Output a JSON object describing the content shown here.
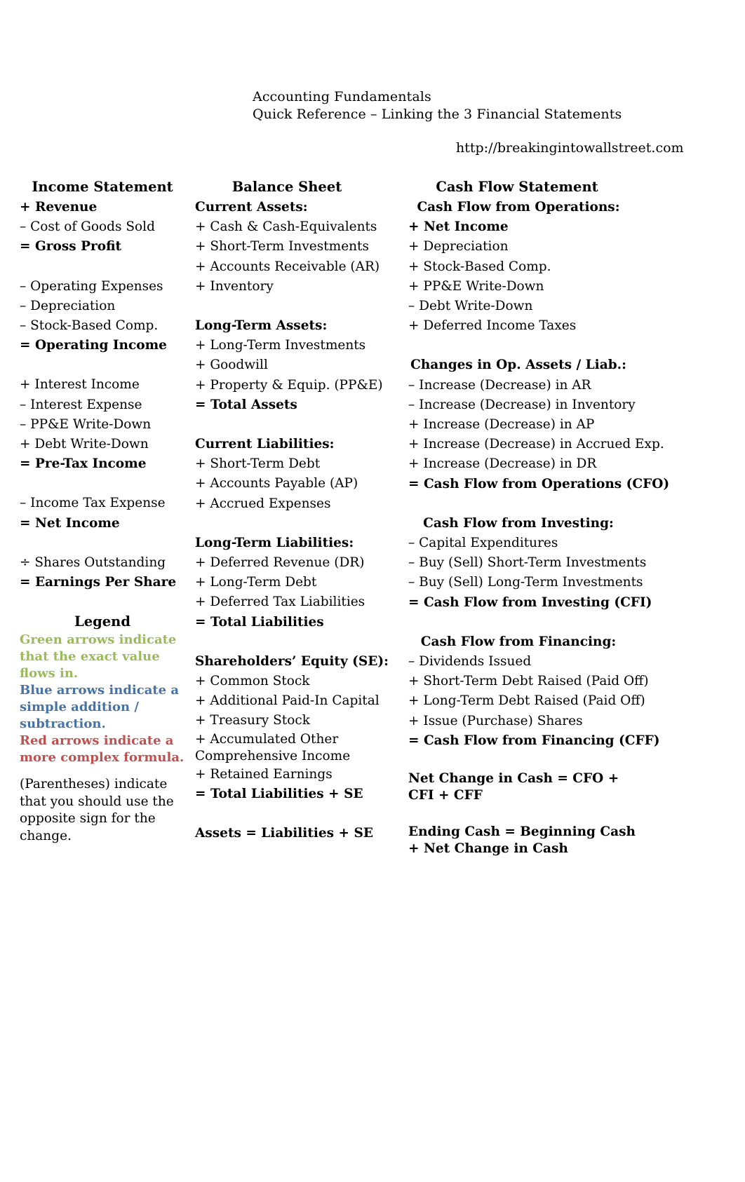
{
  "header": {
    "title_line1": "Accounting Fundamentals",
    "title_line2": "Quick Reference – Linking the 3 Financial Statements",
    "url": "http://breakingintowallstreet.com"
  },
  "colors": {
    "green": "#9BBB59",
    "blue": "#4573A7",
    "red": "#C0504D",
    "text": "#000000"
  },
  "income_statement": {
    "title": "Income Statement",
    "lines": [
      {
        "text": "+ Revenue",
        "bold": true
      },
      {
        "text": "– Cost of Goods Sold",
        "bold": false
      },
      {
        "text": "= Gross Profit",
        "bold": true
      },
      {
        "text": "",
        "bold": false
      },
      {
        "text": "– Operating Expenses",
        "bold": false
      },
      {
        "text": "– Depreciation",
        "bold": false
      },
      {
        "text": "– Stock-Based Comp.",
        "bold": false
      },
      {
        "text": "= Operating Income",
        "bold": true
      },
      {
        "text": "",
        "bold": false
      },
      {
        "text": "+ Interest Income",
        "bold": false
      },
      {
        "text": "– Interest Expense",
        "bold": false
      },
      {
        "text": "– PP&E Write-Down",
        "bold": false
      },
      {
        "text": "+ Debt Write-Down",
        "bold": false
      },
      {
        "text": "= Pre-Tax Income",
        "bold": true
      },
      {
        "text": "",
        "bold": false
      },
      {
        "text": "– Income Tax Expense",
        "bold": false
      },
      {
        "text": "= Net Income",
        "bold": true
      },
      {
        "text": "",
        "bold": false
      },
      {
        "text": "÷ Shares Outstanding",
        "bold": false
      },
      {
        "text": "= Earnings Per Share",
        "bold": true
      }
    ]
  },
  "legend": {
    "title": "Legend",
    "items": [
      {
        "text": "Green arrows indicate that the exact value flows in.",
        "color": "green"
      },
      {
        "text": "Blue arrows indicate a simple addition / subtraction.",
        "color": "blue"
      },
      {
        "text": "Red arrows indicate a more complex formula.",
        "color": "red"
      }
    ],
    "note": "(Parentheses) indicate that you should use the opposite sign for the change."
  },
  "balance_sheet": {
    "title": "Balance Sheet",
    "lines": [
      {
        "text": "Current Assets:",
        "bold": true
      },
      {
        "text": "+ Cash & Cash-Equivalents",
        "bold": false
      },
      {
        "text": "+ Short-Term Investments",
        "bold": false
      },
      {
        "text": "+ Accounts Receivable (AR)",
        "bold": false
      },
      {
        "text": "+ Inventory",
        "bold": false
      },
      {
        "text": "",
        "bold": false
      },
      {
        "text": "Long-Term Assets:",
        "bold": true
      },
      {
        "text": "+ Long-Term Investments",
        "bold": false
      },
      {
        "text": "+ Goodwill",
        "bold": false
      },
      {
        "text": "+ Property & Equip. (PP&E)",
        "bold": false
      },
      {
        "text": "= Total Assets",
        "bold": true
      },
      {
        "text": "",
        "bold": false
      },
      {
        "text": "Current Liabilities:",
        "bold": true
      },
      {
        "text": "+ Short-Term Debt",
        "bold": false
      },
      {
        "text": "+ Accounts Payable (AP)",
        "bold": false
      },
      {
        "text": "+ Accrued Expenses",
        "bold": false
      },
      {
        "text": "",
        "bold": false
      },
      {
        "text": "Long-Term Liabilities:",
        "bold": true
      },
      {
        "text": "+ Deferred Revenue (DR)",
        "bold": false
      },
      {
        "text": "+ Long-Term Debt",
        "bold": false
      },
      {
        "text": "+ Deferred Tax Liabilities",
        "bold": false
      },
      {
        "text": "= Total Liabilities",
        "bold": true
      },
      {
        "text": "",
        "bold": false
      },
      {
        "text": "Shareholders’ Equity (SE):",
        "bold": true
      },
      {
        "text": "+ Common Stock",
        "bold": false
      },
      {
        "text": "+ Additional Paid-In Capital",
        "bold": false
      },
      {
        "text": "+ Treasury Stock",
        "bold": false
      },
      {
        "text": "+ Accumulated Other Comprehensive Income",
        "bold": false,
        "wrap": true
      },
      {
        "text": "+ Retained Earnings",
        "bold": false
      },
      {
        "text": "= Total Liabilities + SE",
        "bold": true
      },
      {
        "text": "",
        "bold": false
      },
      {
        "text": "Assets = Liabilities + SE",
        "bold": true
      }
    ]
  },
  "cash_flow_statement": {
    "title": "Cash Flow Statement",
    "sections": [
      {
        "heading": "Cash Flow from Operations:",
        "lines": [
          {
            "text": "+ Net Income",
            "bold": true
          },
          {
            "text": "+ Depreciation",
            "bold": false
          },
          {
            "text": "+ Stock-Based Comp.",
            "bold": false
          },
          {
            "text": "+ PP&E Write-Down",
            "bold": false
          },
          {
            "text": "– Debt Write-Down",
            "bold": false
          },
          {
            "text": "+ Deferred Income Taxes",
            "bold": false
          }
        ]
      },
      {
        "heading": "Changes in Op. Assets / Liab.:",
        "lines": [
          {
            "text": "– Increase (Decrease) in AR",
            "bold": false
          },
          {
            "text": "– Increase (Decrease) in Inventory",
            "bold": false
          },
          {
            "text": "+ Increase (Decrease) in AP",
            "bold": false
          },
          {
            "text": "+ Increase (Decrease) in Accrued Exp.",
            "bold": false
          },
          {
            "text": "+ Increase (Decrease) in DR",
            "bold": false
          },
          {
            "text": "= Cash Flow from Operations (CFO)",
            "bold": true
          }
        ]
      },
      {
        "heading": "Cash Flow from Investing:",
        "lines": [
          {
            "text": "– Capital Expenditures",
            "bold": false
          },
          {
            "text": "– Buy (Sell) Short-Term Investments",
            "bold": false
          },
          {
            "text": "– Buy (Sell) Long-Term Investments",
            "bold": false
          },
          {
            "text": "= Cash Flow from Investing (CFI)",
            "bold": true
          }
        ]
      },
      {
        "heading": "Cash Flow from Financing:",
        "lines": [
          {
            "text": "– Dividends Issued",
            "bold": false
          },
          {
            "text": "+ Short-Term Debt Raised (Paid Off)",
            "bold": false
          },
          {
            "text": "+ Long-Term Debt Raised (Paid Off)",
            "bold": false
          },
          {
            "text": "+ Issue (Purchase) Shares",
            "bold": false
          },
          {
            "text": "= Cash Flow from Financing (CFF)",
            "bold": true
          }
        ]
      }
    ],
    "footers": [
      "Net Change in Cash = CFO + CFI + CFF",
      "Ending Cash = Beginning Cash + Net Change in Cash"
    ]
  }
}
